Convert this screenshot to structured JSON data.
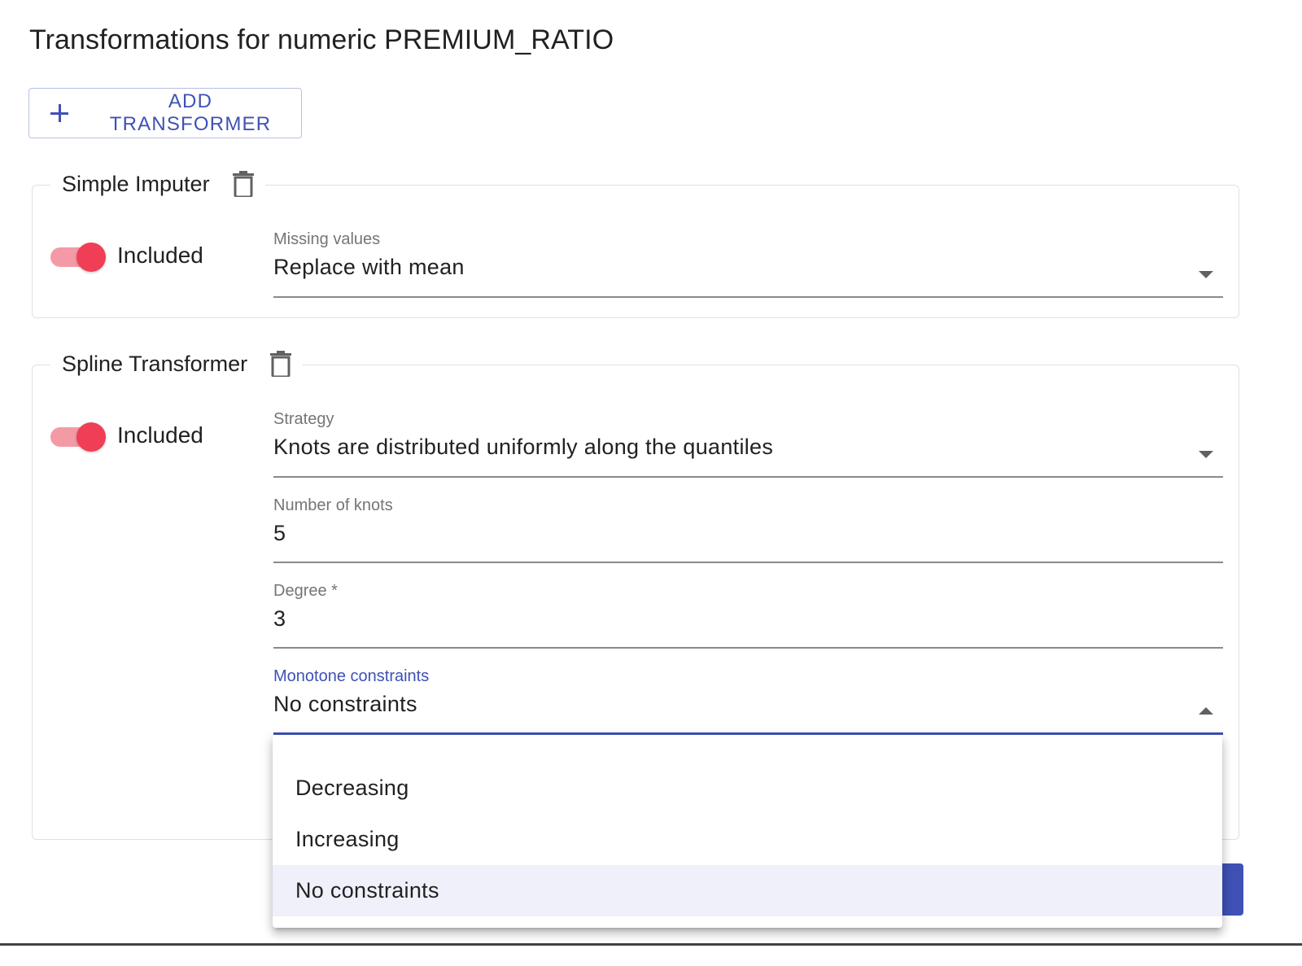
{
  "page": {
    "title": "Transformations for numeric PREMIUM_RATIO"
  },
  "toolbar": {
    "add_label": "ADD TRANSFORMER"
  },
  "simple_imputer": {
    "title": "Simple Imputer",
    "included_label": "Included",
    "included": true,
    "missing_values": {
      "label": "Missing values",
      "value": "Replace with mean"
    }
  },
  "spline_transformer": {
    "title": "Spline Transformer",
    "included_label": "Included",
    "included": true,
    "strategy": {
      "label": "Strategy",
      "value": "Knots are distributed uniformly along the quantiles"
    },
    "n_knots": {
      "label": "Number of knots",
      "value": "5"
    },
    "degree": {
      "label": "Degree *",
      "value": "3"
    },
    "monotone": {
      "label": "Monotone constraints",
      "value": "No constraints",
      "options": [
        "Decreasing",
        "Increasing",
        "No constraints"
      ],
      "selected_index": 2
    }
  },
  "colors": {
    "accent": "#3f51b5",
    "toggle_thumb": "#ef3e56",
    "toggle_track": "#f49aa6",
    "selected_option_bg": "#eff0f9"
  },
  "icons": {
    "add": "plus-icon",
    "delete": "trash-icon",
    "dropdown": "caret-icon"
  }
}
